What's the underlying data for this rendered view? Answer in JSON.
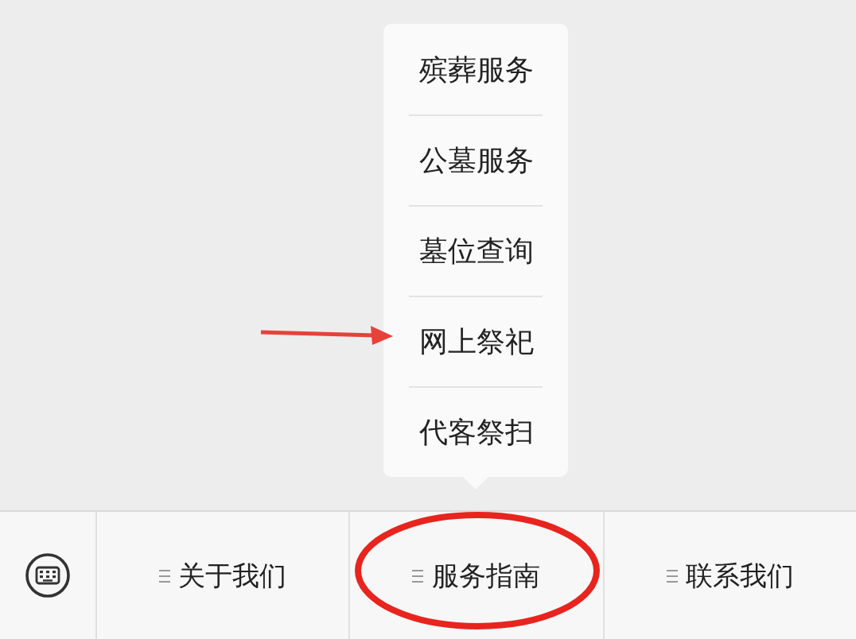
{
  "menu_bar": {
    "items": [
      {
        "label": "关于我们"
      },
      {
        "label": "服务指南",
        "submenu": [
          "殡葬服务",
          "公墓服务",
          "墓位查询",
          "网上祭祀",
          "代客祭扫"
        ]
      },
      {
        "label": "联系我们"
      }
    ]
  }
}
